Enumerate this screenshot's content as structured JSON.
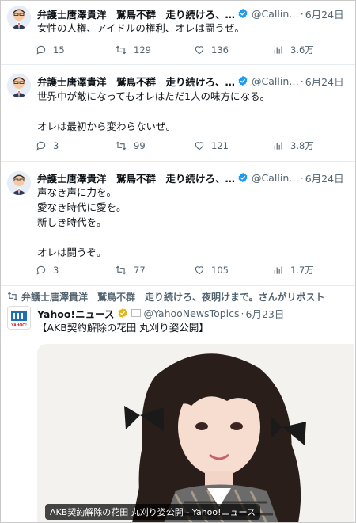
{
  "tweets": [
    {
      "name": "弁護士唐澤貴洋　鷲鳥不群　走り続けろ、…",
      "handle": "@Callin…",
      "date": "6月24日",
      "lines": [
        "女性の人権、アイドルの権利、オレは闘うぜ。"
      ],
      "replies": "15",
      "reposts": "129",
      "likes": "136",
      "views": "3.6万"
    },
    {
      "name": "弁護士唐澤貴洋　鷲鳥不群　走り続けろ、…",
      "handle": "@Callin…",
      "date": "6月24日",
      "lines": [
        "世界中が敵になってもオレはただ1人の味方になる。",
        "",
        "オレは最初から変わらないぜ。"
      ],
      "replies": "3",
      "reposts": "99",
      "likes": "121",
      "views": "3.8万"
    },
    {
      "name": "弁護士唐澤貴洋　鷲鳥不群　走り続けろ、…",
      "handle": "@Callin…",
      "date": "6月24日",
      "lines": [
        "声なき声に力を。",
        "愛なき時代に愛を。",
        "新しき時代を。",
        "",
        "オレは闘うぞ。"
      ],
      "replies": "3",
      "reposts": "77",
      "likes": "105",
      "views": "1.7万"
    }
  ],
  "repost": {
    "text": "弁護士唐澤貴洋　鷲鳥不群　走り続けろ、夜明けまで。さんがリポスト",
    "name": "Yahoo!ニュース",
    "logo_text": "YAHOO!",
    "handle": "@YahooNewsTopics",
    "date": "6月23日",
    "body": "【AKB契約解除の花田 丸刈り姿公開】",
    "caption": "AKB契約解除の花田 丸刈り姿公開 - Yahoo!ニュース"
  },
  "colors": {
    "verified_blue": "#1d9bf0",
    "gold": "#e2b719",
    "muted": "#536471"
  },
  "icons": [
    "reply-icon",
    "repost-icon",
    "like-icon",
    "views-icon",
    "verified-badge-icon",
    "affiliate-badge-icon"
  ]
}
